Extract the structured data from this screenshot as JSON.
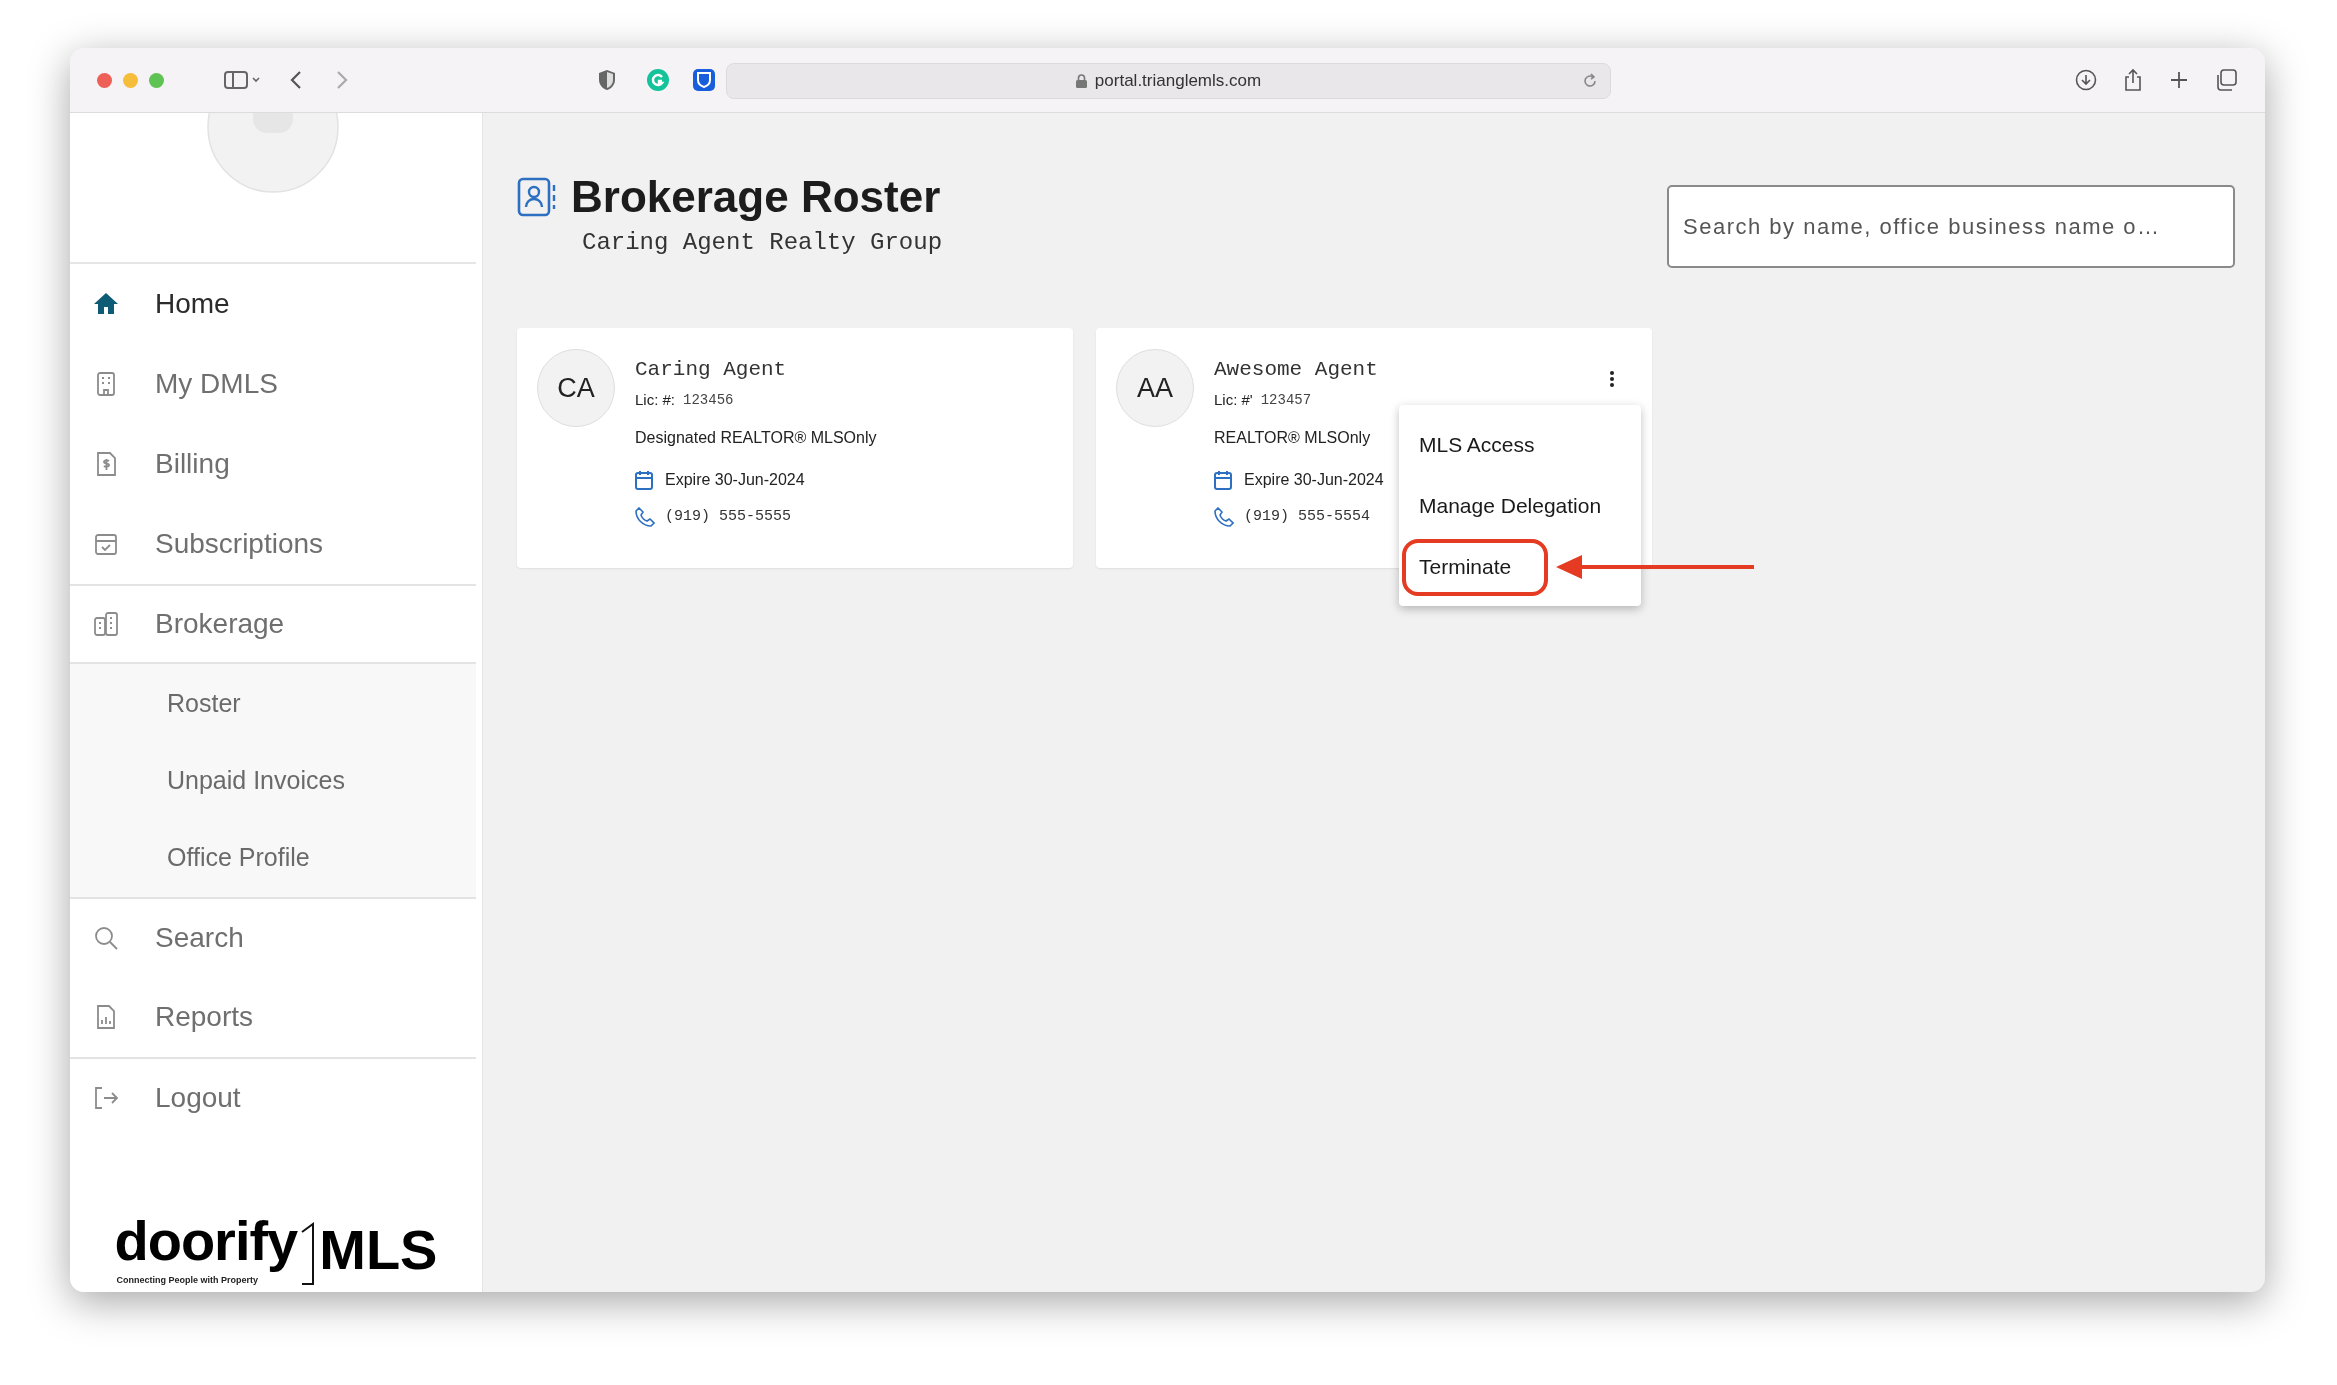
{
  "browser": {
    "url": "portal.trianglemls.com"
  },
  "sidebar": {
    "items": [
      {
        "kind": "home",
        "label": "Home",
        "selected": true
      },
      {
        "kind": "building",
        "label": "My DMLS",
        "selected": false
      },
      {
        "kind": "bill",
        "label": "Billing",
        "selected": false
      },
      {
        "kind": "calendar",
        "label": "Subscriptions",
        "selected": false
      },
      {
        "kind": "buildings",
        "label": "Brokerage",
        "selected": false,
        "expanded": true,
        "children": [
          {
            "label": "Roster",
            "selected": false
          },
          {
            "label": "Unpaid Invoices",
            "selected": false
          },
          {
            "label": "Office Profile",
            "selected": false
          }
        ]
      },
      {
        "kind": "search",
        "label": "Search",
        "selected": false
      },
      {
        "kind": "report",
        "label": "Reports",
        "selected": false
      },
      {
        "kind": "logout",
        "label": "Logout",
        "selected": false
      }
    ],
    "logo": {
      "brand": "doorify",
      "product": "MLS",
      "tagline": "Connecting People with Property"
    }
  },
  "page": {
    "title": "Brokerage Roster",
    "subtitle": "Caring Agent Realty Group",
    "search": {
      "placeholder": "Search by name, office business name o…"
    }
  },
  "cards": [
    {
      "initials": "CA",
      "name": "Caring Agent",
      "license_label": "Lic: #:",
      "license": "123456",
      "role": "Designated REALTOR® MLSOnly",
      "expire": "Expire 30-Jun-2024",
      "phone": "(919) 555-5555",
      "menu_open": false
    },
    {
      "initials": "AA",
      "name": "Awesome Agent",
      "license_label": "Lic: #'",
      "license": "123457",
      "role": "REALTOR® MLSOnly",
      "expire": "Expire 30-Jun-2024",
      "phone": "(919) 555-5554",
      "menu_open": true
    }
  ],
  "menu": {
    "items": [
      {
        "label": "MLS Access",
        "annotated": false
      },
      {
        "label": "Manage Delegation",
        "annotated": false
      },
      {
        "label": "Terminate",
        "annotated": true
      }
    ]
  }
}
